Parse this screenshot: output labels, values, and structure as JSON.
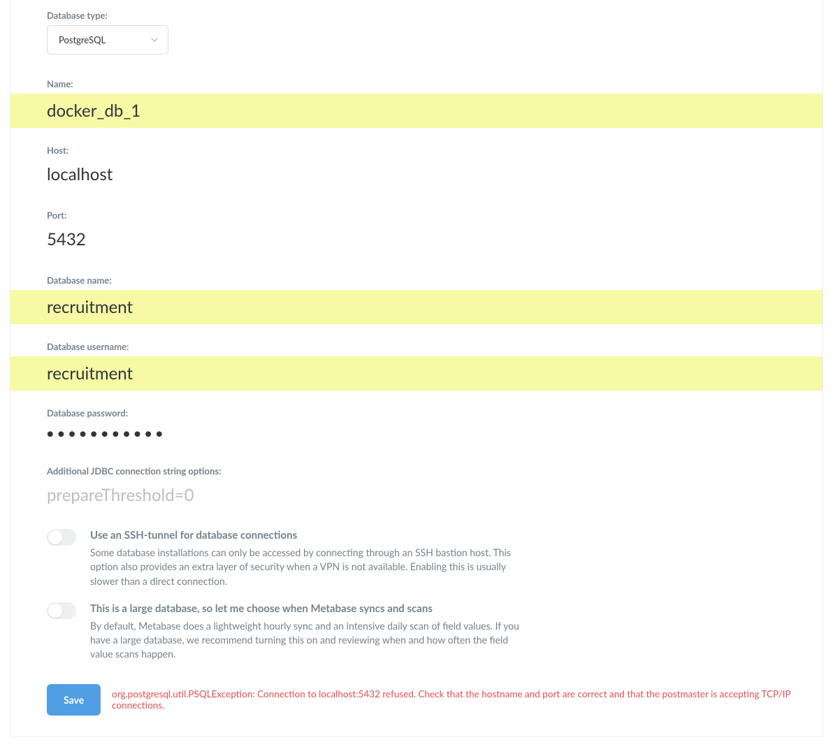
{
  "fields": {
    "db_type": {
      "label": "Database type:",
      "value": "PostgreSQL"
    },
    "name": {
      "label": "Name:",
      "value": "docker_db_1",
      "highlighted": true
    },
    "host": {
      "label": "Host:",
      "value": "localhost",
      "highlighted": false
    },
    "port": {
      "label": "Port:",
      "value": "5432",
      "highlighted": false
    },
    "db_name": {
      "label": "Database name:",
      "value": "recruitment",
      "highlighted": true
    },
    "db_username": {
      "label": "Database username:",
      "value": "recruitment",
      "highlighted": true
    },
    "db_password": {
      "label": "Database password:",
      "value": "●●●●●●●●●●●",
      "highlighted": false
    },
    "jdbc": {
      "label": "Additional JDBC connection string options:",
      "value": "",
      "placeholder": "prepareThreshold=0",
      "highlighted": false
    }
  },
  "toggles": {
    "ssh": {
      "title": "Use an SSH-tunnel for database connections",
      "desc": "Some database installations can only be accessed by connecting through an SSH bastion host. This option also provides an extra layer of security when a VPN is not available. Enabling this is usually slower than a direct connection."
    },
    "large_db": {
      "title": "This is a large database, so let me choose when Metabase syncs and scans",
      "desc": "By default, Metabase does a lightweight hourly sync and an intensive daily scan of field values. If you have a large database, we recommend turning this on and reviewing when and how often the field value scans happen."
    }
  },
  "footer": {
    "save_label": "Save",
    "error": "org.postgresql.util.PSQLException: Connection to localhost:5432 refused. Check that the hostname and port are correct and that the postmaster is accepting TCP/IP connections."
  }
}
